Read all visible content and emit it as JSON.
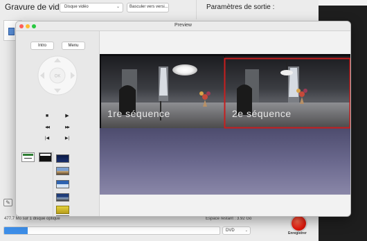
{
  "background_app": {
    "title": "Gravure de vidéos",
    "disc_type": "Disque vidéo",
    "switch_button": "Basculer vers versi...",
    "output_settings_title": "Paramètres de sortie :",
    "status_text": "477.7 Mo sur 1 disque optique",
    "remaining_space": "Espace restant : 3.92 Go",
    "progress_fraction": 0.11,
    "format": "DVD",
    "record_label": "Enregistrer",
    "accent_color": "#3d8ee8",
    "record_color": "#e0180d"
  },
  "preview": {
    "window_title": "Preview",
    "intro_label": "Intro",
    "menu_label": "Menu",
    "ok_label": "OK",
    "controls": {
      "stop": "■",
      "play": "▶",
      "rewind": "◀◀",
      "fast_forward": "▶▶",
      "previous": "|◀",
      "next": "▶|"
    },
    "chapters": [
      "1re séquence",
      "2e séquence"
    ],
    "selected_chapter": 2,
    "selection_color": "#c81e1e"
  }
}
